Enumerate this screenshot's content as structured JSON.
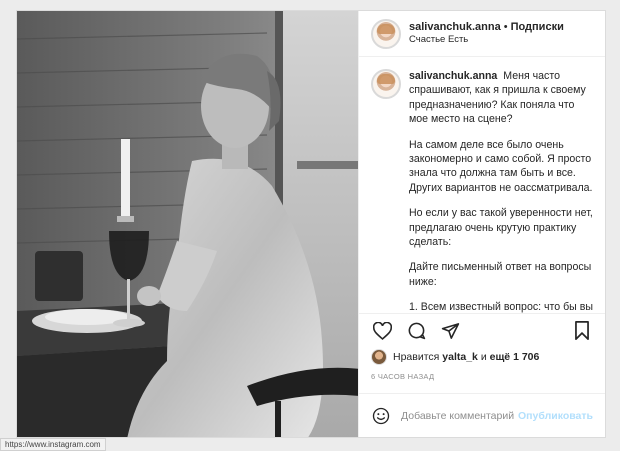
{
  "post": {
    "author": "salivanchuk.anna",
    "separator": "•",
    "follow_label": "Подписки",
    "location": "Счастье Есть",
    "caption_paragraphs": [
      "Меня часто спрашивают, как я пришла к своему предназначению? Как поняла что мое место на сцене?",
      "На самом деле все было очень закономерно и само собой. Я просто знала что должна там быть и все. Других вариантов не оассматривала.",
      "Но если у вас такой уверенности нет, предлагаю очень крутую практику сделать:",
      "Дайте письменный ответ на вопросы ниже:",
      "1. Всем известный вопрос: что бы вы"
    ],
    "likes": {
      "prefix": "Нравится",
      "user": "yalta_k",
      "conjunction": "и",
      "rest": "ещё 1 706"
    },
    "time": "6 ЧАСОВ НАЗАД",
    "comment_placeholder": "Добавьте комментарий...",
    "publish_label": "Опубликовать"
  },
  "icons": {
    "like": "heart-icon",
    "comment": "comment-bubble-icon",
    "share": "paper-plane-icon",
    "save": "bookmark-icon",
    "emoji": "smiley-icon"
  },
  "status_bar": {
    "url": "https://www.instagram.com"
  },
  "colors": {
    "publish_disabled": "#b2dffc",
    "meta_gray": "#8e8e8e",
    "text": "#262626"
  }
}
